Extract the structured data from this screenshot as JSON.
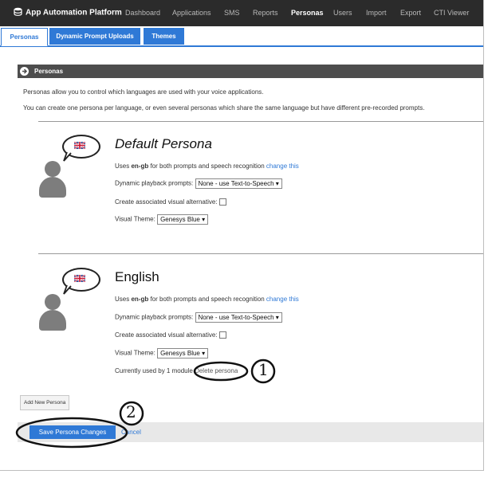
{
  "app": {
    "title": "App Automation Platform"
  },
  "topnav": [
    {
      "label": "Dashboard",
      "active": false
    },
    {
      "label": "Applications",
      "active": false
    },
    {
      "label": "SMS",
      "active": false
    },
    {
      "label": "Reports",
      "active": false
    },
    {
      "label": "Personas",
      "active": true
    },
    {
      "label": "Users",
      "active": false
    },
    {
      "label": "Import",
      "active": false
    },
    {
      "label": "Export",
      "active": false
    },
    {
      "label": "CTI Viewer",
      "active": false
    }
  ],
  "tabs": [
    {
      "label": "Personas",
      "active": true
    },
    {
      "label": "Dynamic Prompt Uploads",
      "active": false
    },
    {
      "label": "Themes",
      "active": false
    }
  ],
  "section": {
    "title": "Personas",
    "desc1": "Personas allow you to control which languages are used with your voice applications.",
    "desc2": "You can create one persona per language, or even several personas which share the same language but have different pre-recorded prompts."
  },
  "personas": [
    {
      "name": "Default Persona",
      "uses_prefix": "Uses ",
      "lang": "en-gb",
      "uses_suffix": " for both prompts and speech recognition ",
      "change_link": "change this",
      "playback_label": "Dynamic playback prompts:",
      "playback_value": "None - use Text-to-Speech ▾",
      "visual_alt_label": "Create associated visual alternative:",
      "theme_label": "Visual Theme:",
      "theme_value": "Genesys Blue ▾"
    },
    {
      "name": "English",
      "uses_prefix": "Uses ",
      "lang": "en-gb",
      "uses_suffix": " for both prompts and speech recognition ",
      "change_link": "change this",
      "playback_label": "Dynamic playback prompts:",
      "playback_value": "None - use Text-to-Speech ▾",
      "visual_alt_label": "Create associated visual alternative:",
      "theme_label": "Visual Theme:",
      "theme_value": "Genesys Blue ▾",
      "usage_text": "Currently used by 1 module",
      "delete_link": "Delete persona"
    }
  ],
  "actions": {
    "add_label": "Add New Persona",
    "save_label": "Save Persona Changes",
    "cancel_label": "Cancel"
  },
  "annotations": {
    "one": "1",
    "two": "2"
  },
  "colors": {
    "accent": "#2f79d6",
    "nav_bg": "#2b2b2b",
    "section_bg": "#4d4d4d"
  },
  "icons": {
    "brand": "database-icon",
    "section": "arrow-circle-icon",
    "avatar": "person-icon",
    "flag": "uk-flag-icon"
  }
}
